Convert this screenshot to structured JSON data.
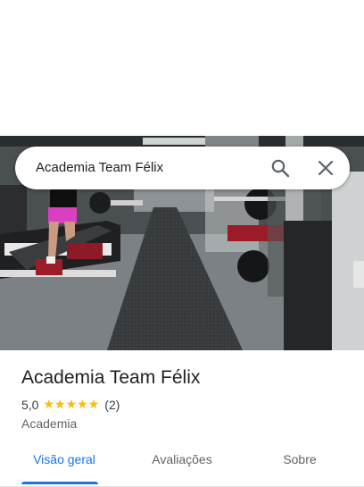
{
  "search": {
    "query": "Academia Team Félix"
  },
  "place": {
    "name": "Academia Team Félix",
    "rating": "5,0",
    "review_count": "(2)",
    "stars": 5,
    "category": "Academia"
  },
  "tabs": [
    {
      "label": "Visão geral",
      "active": true
    },
    {
      "label": "Avaliações",
      "active": false
    },
    {
      "label": "Sobre",
      "active": false
    }
  ],
  "colors": {
    "accent": "#1a73e8",
    "star": "#fbbc04",
    "title": "#202124"
  },
  "icons": {
    "search": "search-icon",
    "close": "close-icon",
    "star": "star-icon"
  }
}
